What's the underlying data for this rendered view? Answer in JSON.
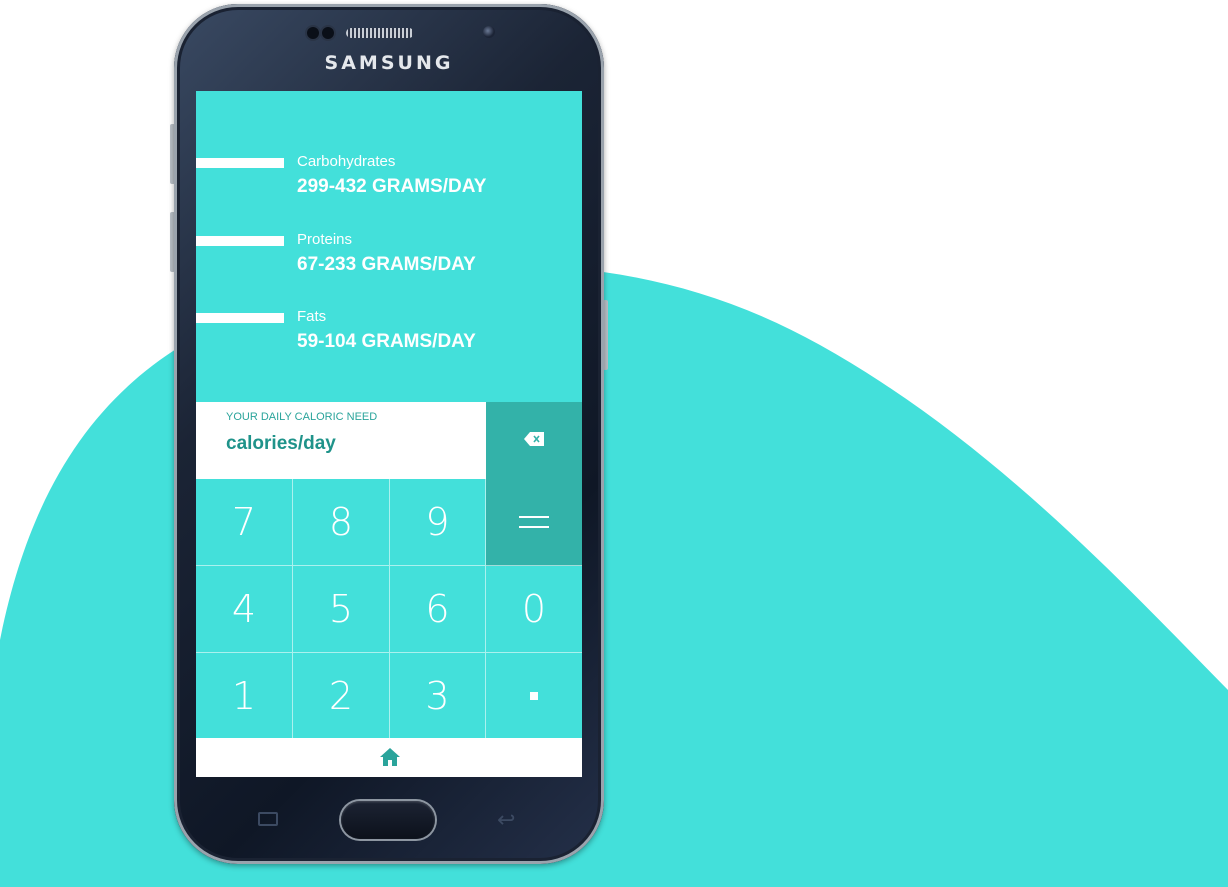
{
  "device": {
    "brand": "SAMSUNG"
  },
  "colors": {
    "accent": "#43e0da",
    "accent_dark": "#33b2a9",
    "text_dark": "#1f938a"
  },
  "macros": [
    {
      "name": "Carbohydrates",
      "range": "299-432 GRAMS/DAY"
    },
    {
      "name": "Proteins",
      "range": "67-233 GRAMS/DAY"
    },
    {
      "name": "Fats",
      "range": "59-104 GRAMS/DAY"
    }
  ],
  "calculator": {
    "hint": "YOUR DAILY CALORIC NEED",
    "placeholder": "calories/day",
    "backspace_icon": "backspace-icon",
    "keys": {
      "seven": "7",
      "eight": "8",
      "nine": "9",
      "four": "4",
      "five": "5",
      "six": "6",
      "zero": "0",
      "one": "1",
      "two": "2",
      "three": "3"
    },
    "equals_icon": "equals-icon",
    "decimal_icon": "decimal-point-icon"
  },
  "bottom_nav": {
    "home_icon": "home-icon"
  },
  "hardware_nav": {
    "recent_icon": "recent-apps-icon",
    "back_icon": "back-icon"
  }
}
